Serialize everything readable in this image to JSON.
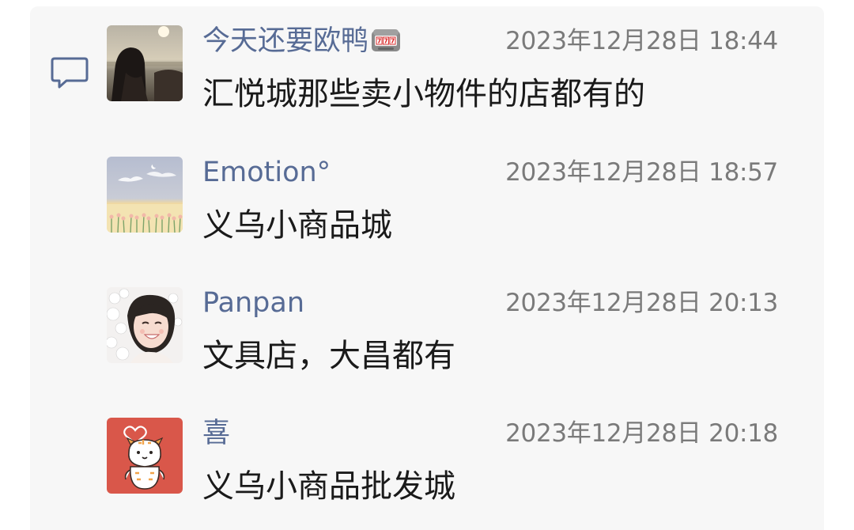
{
  "comments": [
    {
      "author": "今天还要欧鸭",
      "author_emoji_icon": "slot-machine-icon",
      "time": "2023年12月28日 18:44",
      "text": "汇悦城那些卖小物件的店都有的",
      "avatar": "girl-sunset-avatar"
    },
    {
      "author": "Emotion°",
      "time": "2023年12月28日 18:57",
      "text": "义乌小商品城",
      "avatar": "flower-field-avatar"
    },
    {
      "author": "Panpan",
      "time": "2023年12月28日 20:13",
      "text": "文具店，大昌都有",
      "avatar": "smiling-girl-flowers-avatar"
    },
    {
      "author": "喜",
      "time": "2023年12月28日 20:18",
      "text": "义乌小商品批发城",
      "avatar": "cartoon-tiger-avatar"
    }
  ],
  "colors": {
    "author": "#576b95",
    "time": "#7a7a7a",
    "text": "#1a1a1a",
    "panel": "#f7f7f7"
  }
}
